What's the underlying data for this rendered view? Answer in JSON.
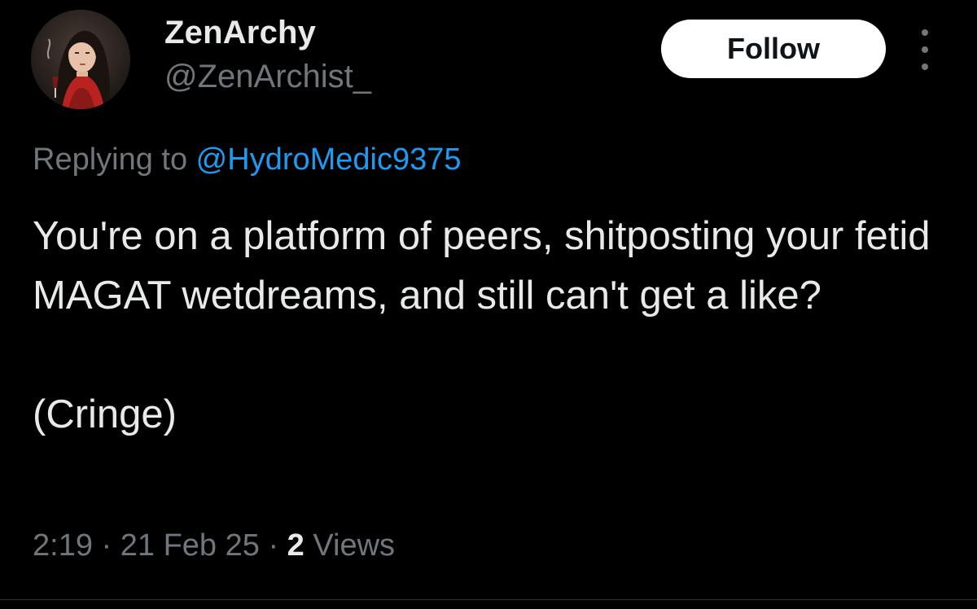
{
  "author": {
    "display_name": "ZenArchy",
    "handle": "@ZenArchist_"
  },
  "actions": {
    "follow_label": "Follow",
    "more_icon": "more-vertical-icon"
  },
  "reply": {
    "prefix": "Replying to ",
    "mention": "@HydroMedic9375"
  },
  "tweet": {
    "text": "You're on a platform of peers, shitposting your fetid MAGAT wetdreams, and still can't get a like?\n\n(Cringe)"
  },
  "meta": {
    "time": "2:19",
    "separator": " · ",
    "date": "21 Feb 25",
    "views_count": "2",
    "views_label": " Views"
  },
  "colors": {
    "background": "#000000",
    "primary_text": "#e7e9ea",
    "secondary_text": "#71767b",
    "link": "#1d9bf0",
    "follow_button_bg": "#ffffff"
  }
}
